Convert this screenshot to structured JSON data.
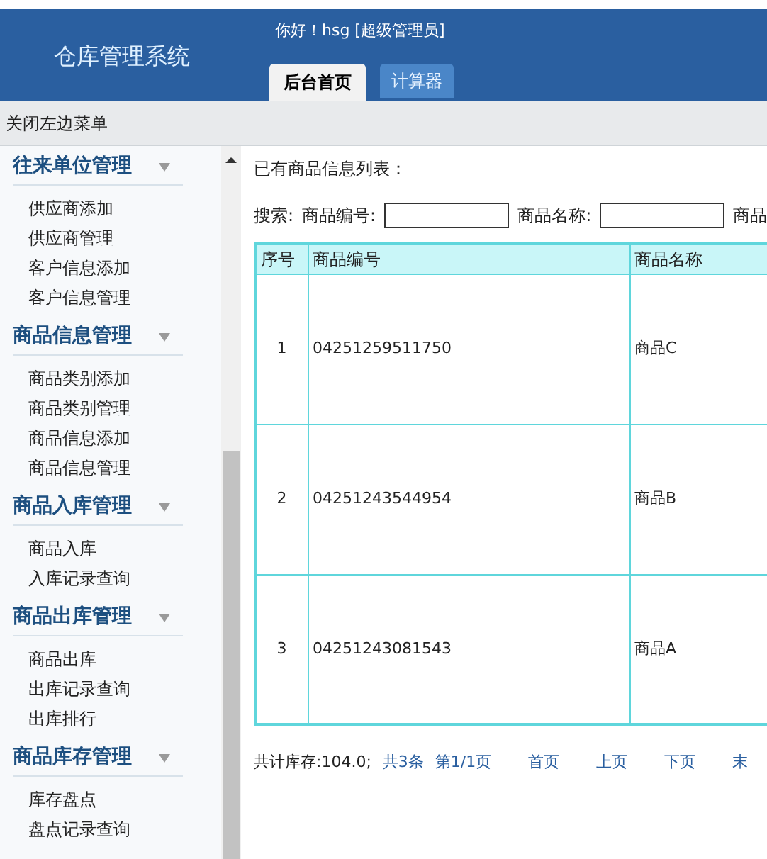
{
  "header": {
    "title": "仓库管理系统",
    "greeting": "你好！hsg [超级管理员]",
    "tabs": [
      {
        "label": "后台首页",
        "selected": true
      },
      {
        "label": "计算器",
        "selected": false
      }
    ]
  },
  "toolbar": {
    "toggle": "关闭左边菜单"
  },
  "sidebar": {
    "groups": [
      {
        "title": "往来单位管理",
        "expanded": true,
        "items": [
          "供应商添加",
          "供应商管理",
          "客户信息添加",
          "客户信息管理"
        ]
      },
      {
        "title": "商品信息管理",
        "expanded": true,
        "items": [
          "商品类别添加",
          "商品类别管理",
          "商品信息添加",
          "商品信息管理"
        ]
      },
      {
        "title": "商品入库管理",
        "expanded": true,
        "items": [
          "商品入库",
          "入库记录查询"
        ]
      },
      {
        "title": "商品出库管理",
        "expanded": true,
        "items": [
          "商品出库",
          "出库记录查询",
          "出库排行"
        ]
      },
      {
        "title": "商品库存管理",
        "expanded": true,
        "items": [
          "库存盘点",
          "盘点记录查询"
        ]
      }
    ]
  },
  "content": {
    "heading": "已有商品信息列表：",
    "search": {
      "label": "搜索:",
      "fields": [
        {
          "label": "商品编号:"
        },
        {
          "label": "商品名称:"
        }
      ],
      "cut_label": "商品"
    },
    "table": {
      "columns": [
        "序号",
        "商品编号",
        "商品名称"
      ],
      "rows": [
        [
          "1",
          "04251259511750",
          "商品C"
        ],
        [
          "2",
          "04251243544954",
          "商品B"
        ],
        [
          "3",
          "04251243081543",
          "商品A"
        ]
      ]
    },
    "pagination": {
      "summary": "共计库存:104.0;",
      "count": "共3条",
      "page": "第1/1页",
      "links": [
        "首页",
        "上页",
        "下页",
        "末"
      ]
    }
  }
}
